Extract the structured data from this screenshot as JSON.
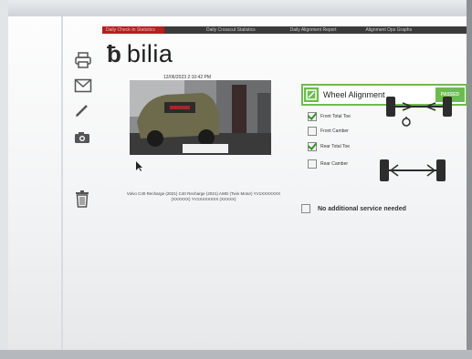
{
  "nav": {
    "items": [
      "Daily Check-In Statistics",
      "Daily Crosscut Statistics",
      "Daily Alignment Report",
      "Alignment Ops Graphs"
    ]
  },
  "brand": {
    "name": "bilia",
    "mark": "ƀ"
  },
  "sidebar": {
    "icons": [
      "printer-icon",
      "mail-icon",
      "pencil-icon",
      "camera-icon",
      "trash-icon"
    ]
  },
  "vehicle": {
    "timestamp": "12/06/2023 2:10:42 PM",
    "caption": "Volvo C40 Recharge (2021) C40 Recharge (2021) AWD (Twin Motor) YV1XXXXXXX (XXXXXX) YV1XXXXXXX (XXXXX)"
  },
  "service": {
    "name": "Wheel Alignment",
    "status": "PASSED",
    "options": [
      {
        "label": "Front Total Toe",
        "checked": true
      },
      {
        "label": "Front Camber",
        "checked": false
      },
      {
        "label": "Rear Total Toe",
        "checked": true
      },
      {
        "label": "Rear Camber",
        "checked": false
      }
    ],
    "no_service_label": "No additional service needed",
    "no_service_checked": false
  },
  "colors": {
    "accent_green": "#6dbb4e",
    "nav_active_red": "#b32020",
    "nav_bar": "#3b3b3b"
  }
}
